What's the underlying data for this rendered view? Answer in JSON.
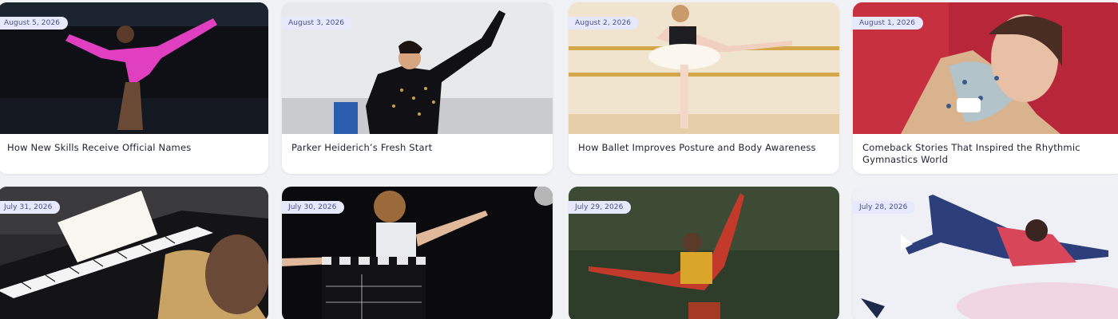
{
  "articles": [
    {
      "date": "August 5, 2026",
      "title": "How New Skills Receive Official Names",
      "image": "gymnast-pink-leotard-balance"
    },
    {
      "date": "August 3, 2026",
      "title": "Parker Heiderich’s Fresh Start",
      "image": "figure-skater-black-costume"
    },
    {
      "date": "August 2, 2026",
      "title": "How Ballet Improves Posture and Body Awareness",
      "image": "ballerina-at-barre"
    },
    {
      "date": "August 1, 2026",
      "title": "Comeback Stories That Inspired the Rhythmic Gymnastics World",
      "image": "rhythmic-gymnast-close-up"
    },
    {
      "date": "July 31, 2026",
      "title": "",
      "image": "child-playing-piano"
    },
    {
      "date": "July 30, 2026",
      "title": "",
      "image": "young-actor-with-clapperboard"
    },
    {
      "date": "July 29, 2026",
      "title": "",
      "image": "gymnast-on-balance-beam"
    },
    {
      "date": "July 28, 2026",
      "title": "",
      "image": "figure-skater-spread-eagle"
    }
  ],
  "colors": {
    "badge_bg": "#e6e8fb",
    "badge_text": "#4a4f8a",
    "card_bg": "#ffffff",
    "page_bg": "#f1f2f6"
  }
}
